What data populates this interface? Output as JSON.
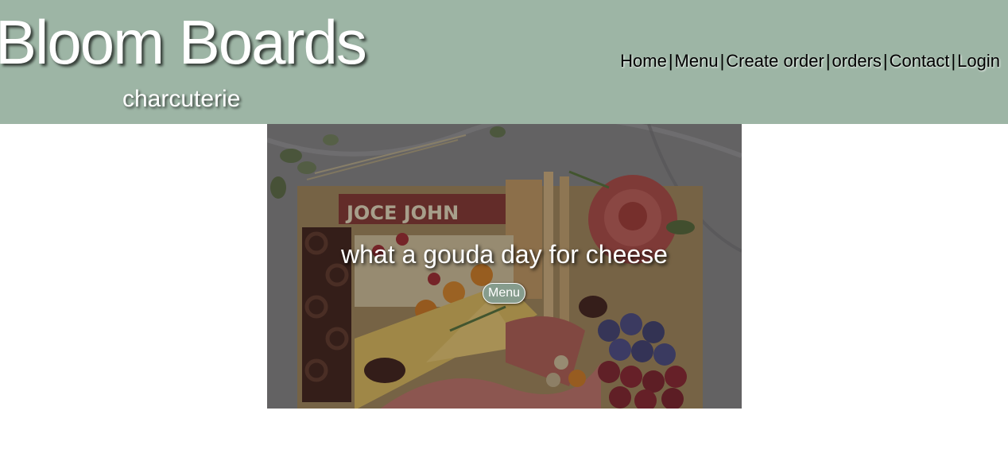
{
  "brand": {
    "title": "Bloom Boards",
    "subtitle": "charcuterie"
  },
  "nav": {
    "items": [
      {
        "label": "Home"
      },
      {
        "label": "Menu"
      },
      {
        "label": "Create order"
      },
      {
        "label": "orders"
      },
      {
        "label": "Contact"
      },
      {
        "label": "Login"
      }
    ],
    "separator": "|"
  },
  "hero": {
    "caption": "what a gouda day for cheese",
    "button_label": "Menu",
    "image_text": "JOCE JOHN"
  },
  "colors": {
    "header_bg": "#9db5a5",
    "button_bg": "#869c8d",
    "page_bg": "#ffffff"
  }
}
